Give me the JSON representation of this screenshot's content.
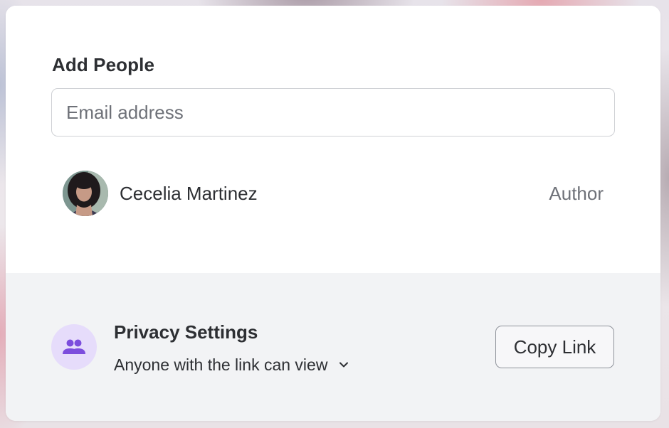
{
  "add_people": {
    "title": "Add People",
    "email_placeholder": "Email address",
    "email_value": ""
  },
  "people": [
    {
      "name": "Cecelia Martinez",
      "role": "Author",
      "avatar": "user-photo"
    }
  ],
  "privacy": {
    "icon": "people-group-icon",
    "title": "Privacy Settings",
    "selected_option": "Anyone with the link can view",
    "copy_link_label": "Copy Link"
  },
  "colors": {
    "privacy_icon_bg": "#e6dcfb",
    "privacy_icon_fg": "#7c4ddd",
    "footer_bg": "#f2f3f5"
  }
}
